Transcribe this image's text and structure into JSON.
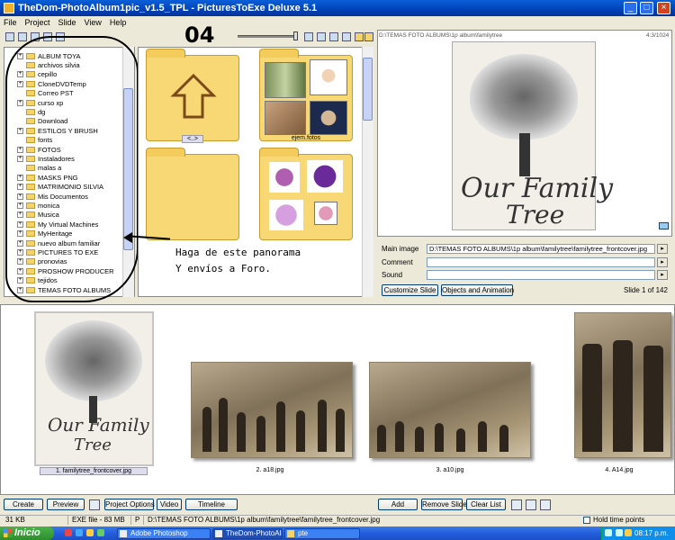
{
  "window": {
    "title": "TheDom-PhotoAlbum1pic_v1.5_TPL - PicturesToExe Deluxe 5.1",
    "minimize": "_",
    "maximize": "□",
    "close": "×"
  },
  "menu": [
    "File",
    "Project",
    "Slide",
    "View",
    "Help"
  ],
  "overlay": {
    "number": "04",
    "note_line1": "Haga de este panorama",
    "note_line2": "Y envíos a Foro."
  },
  "folder_tree": [
    {
      "label": "ALBUM TOYA",
      "expandable": true
    },
    {
      "label": "archivos silvia",
      "expandable": false
    },
    {
      "label": "cepillo",
      "expandable": true
    },
    {
      "label": "CloneDVDTemp",
      "expandable": true
    },
    {
      "label": "Correo PST",
      "expandable": false
    },
    {
      "label": "curso xp",
      "expandable": true
    },
    {
      "label": "dg",
      "expandable": false
    },
    {
      "label": "Download",
      "expandable": false
    },
    {
      "label": "ESTILOS Y BRUSH",
      "expandable": true
    },
    {
      "label": "fonts",
      "expandable": false
    },
    {
      "label": "FOTOS",
      "expandable": true
    },
    {
      "label": "Instaladores",
      "expandable": true
    },
    {
      "label": "malas a",
      "expandable": false
    },
    {
      "label": "MASKS PNG",
      "expandable": true
    },
    {
      "label": "MATRIMONIO SILVIA",
      "expandable": true
    },
    {
      "label": "Mis Documentos",
      "expandable": true
    },
    {
      "label": "monica",
      "expandable": true
    },
    {
      "label": "Musica",
      "expandable": true
    },
    {
      "label": "My Virtual Machines",
      "expandable": true
    },
    {
      "label": "MyHeritage",
      "expandable": true
    },
    {
      "label": "nuevo album familiar",
      "expandable": true
    },
    {
      "label": "PICTURES TO EXE",
      "expandable": true
    },
    {
      "label": "pronovias",
      "expandable": true
    },
    {
      "label": "PROSHOW PRODUCER",
      "expandable": true
    },
    {
      "label": "tejidos",
      "expandable": true
    },
    {
      "label": "TEMAS FOTO ALBUMS",
      "expandable": true
    }
  ],
  "browser": {
    "up_caption": "<..>",
    "folder_caption": "ejem.fotos"
  },
  "preview": {
    "path": "D:\\TEMAS FOTO ALBUMS\\1p album\\familytree",
    "resolution": "4:3/1024",
    "title_line1": "Our Family",
    "title_line2": "Tree"
  },
  "properties": {
    "main_image_label": "Main image",
    "main_image_value": "D:\\TEMAS FOTO ALBUMS\\1p album\\familytree\\familytree_frontcover.jpg",
    "comment_label": "Comment",
    "comment_value": "",
    "sound_label": "Sound",
    "sound_value": "",
    "customize_btn": "Customize Slide",
    "objects_btn": "Objects and Animation",
    "slide_count": "Slide 1 of 142"
  },
  "slides": [
    {
      "caption": "1. familytree_frontcover.jpg"
    },
    {
      "caption": "2. a18.jpg"
    },
    {
      "caption": "3. a10.jpg"
    },
    {
      "caption": "4. A14.jpg"
    }
  ],
  "slide1": {
    "title_line1": "Our Family",
    "title_line2": "Tree"
  },
  "bottom_buttons": {
    "create": "Create",
    "preview": "Preview",
    "project_options": "Project Options",
    "video": "Video",
    "timeline": "Timeline",
    "add": "Add",
    "remove_slide": "Remove Slide",
    "clear_list": "Clear List"
  },
  "status": {
    "size": "31 KB",
    "exe_file": "EXE file - 83 MB",
    "p": "P",
    "path": "D:\\TEMAS FOTO ALBUMS\\1p album\\familytree\\familytree_frontcover.jpg",
    "hold_label": "Hold time points"
  },
  "taskbar": {
    "start": "Inicio",
    "tasks": [
      "Adobe Photoshop",
      "TheDom-PhotoAlb...",
      "pte"
    ],
    "clock": "08:17 p.m."
  },
  "colors": {
    "titlebar": "#0042b8",
    "folder": "#f8d874",
    "taskbar": "#245edc",
    "start": "#2c8e2c"
  }
}
